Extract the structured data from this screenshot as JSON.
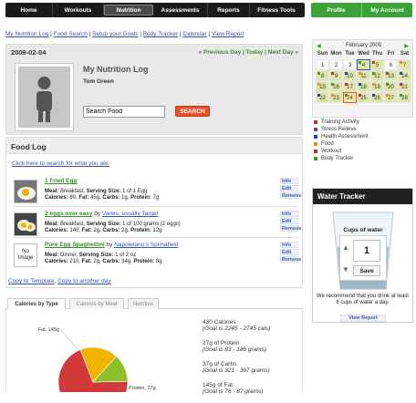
{
  "topnav": [
    "Home",
    "Workouts",
    "Nutrition",
    "Assessments",
    "Reports",
    "Fitness Tools"
  ],
  "usernav": [
    "Profile",
    "My Account"
  ],
  "subnav": [
    "My Nutrition Log",
    "Food Search",
    "Setup your Goals",
    "Body Tracker",
    "Calendar",
    "View Report"
  ],
  "header": {
    "date": "2009-02-04",
    "prev_day": "« Previous Day",
    "today": "Today",
    "next_day": "Next Day »",
    "title": "My Nutrition Log",
    "user": "Tom Green",
    "search_value": "Search Food",
    "search_button": "SEARCH"
  },
  "food_log": {
    "title": "Food Log",
    "search_link": "Click here to search for what you ate.",
    "entries": [
      {
        "name": "1 Fried Egg",
        "by": "",
        "brand": "",
        "meal": "Breakfast",
        "serving": "1 of 1 Egg",
        "calories": "80",
        "fat": "45g",
        "carbs": "1g",
        "protein": "7g",
        "thumb": "fried-egg-image"
      },
      {
        "name": "2 eggs over easy",
        "by": "by",
        "brand": "Varies, usually Target",
        "meal": "Breakfast",
        "serving": "1 of 100 grams (2 eggs)",
        "calories": "140",
        "fat": "2g",
        "carbs": "2g",
        "protein": "12g",
        "thumb": "eggs-over-easy-image"
      },
      {
        "name": "Pure Egg Spaghettini",
        "by": "by",
        "brand": "Napoletano's Sprinafield",
        "meal": "Dinner",
        "serving": "1 of 2 oz",
        "calories": "210",
        "fat": "2g",
        "carbs": "34g",
        "protein": "8g",
        "thumb": "No Image"
      }
    ],
    "actions": [
      "Info",
      "Edit",
      "Remove"
    ],
    "labels": {
      "meal": "Meal:",
      "serving": "Serving Size:",
      "calories": "Calories:",
      "fat": "Fat:",
      "carbs": "Carbs:",
      "protein": "Protein:"
    },
    "copy_template": "Copy to Template",
    "copy_day": "Copy to another day",
    "copy_sep": ","
  },
  "tabs": [
    "Calories by Type",
    "Calories by Meal",
    "Nutrition"
  ],
  "chart_data": {
    "type": "pie",
    "labels": [
      "Fat, 145g",
      "Protein, 27g"
    ],
    "slices": [
      {
        "name": "Fat",
        "value": 145,
        "color": "#d23a3a"
      },
      {
        "name": "Carbs",
        "value": 37,
        "color": "#f0b400"
      },
      {
        "name": "Protein",
        "value": 27,
        "color": "#8bbf2a"
      }
    ]
  },
  "summary": [
    {
      "value": "430 Calories",
      "goal": "(Goal is 2245 - 2745 cals)"
    },
    {
      "value": "27g of Protein",
      "goal": "(Goal is 83 - 186 grams)"
    },
    {
      "value": "37g of Carbs",
      "goal": "(Goal is 321 - 367 grams)"
    },
    {
      "value": "145g of Fat",
      "goal": "(Goal is 76 - 87 grams)"
    }
  ],
  "calendar": {
    "month": "February 2009",
    "prev": "◀",
    "next": "▶",
    "weekdays": [
      "Sun",
      "Mon",
      "Tue",
      "Wed",
      "Thu",
      "Fri",
      "Sat"
    ],
    "days": [
      "1",
      "2",
      "3",
      "4",
      "5",
      "6",
      "7",
      "8",
      "9",
      "10",
      "11",
      "12",
      "13",
      "14",
      "15",
      "16",
      "17",
      "18",
      "19",
      "20",
      "21",
      "22",
      "23",
      "24",
      "25",
      "26",
      "27",
      "28"
    ],
    "logged_days": [
      "4",
      "5",
      "7",
      "8",
      "9",
      "10",
      "11",
      "12",
      "13",
      "14",
      "15",
      "16",
      "17",
      "18",
      "19",
      "20",
      "21",
      "22",
      "23",
      "24",
      "25",
      "26",
      "27",
      "28"
    ],
    "today": "24",
    "selected": "4"
  },
  "legend": [
    {
      "label": "Training Activity",
      "color": "#c03030"
    },
    {
      "label": "Stress Relieve",
      "color": "#7a3aa0"
    },
    {
      "label": "Health Assessment",
      "color": "#2244aa"
    },
    {
      "label": "Food",
      "color": "#e89020"
    },
    {
      "label": "Workout",
      "color": "#c03030"
    },
    {
      "label": "Body Tracker",
      "color": "#3a9a2c"
    }
  ],
  "water": {
    "title": "Water Tracker",
    "cups_label": "Cups of water",
    "count": "1",
    "save": "Save",
    "message": "We recommend that you drink at least 8 cups of water a day.",
    "report": "View Report"
  }
}
